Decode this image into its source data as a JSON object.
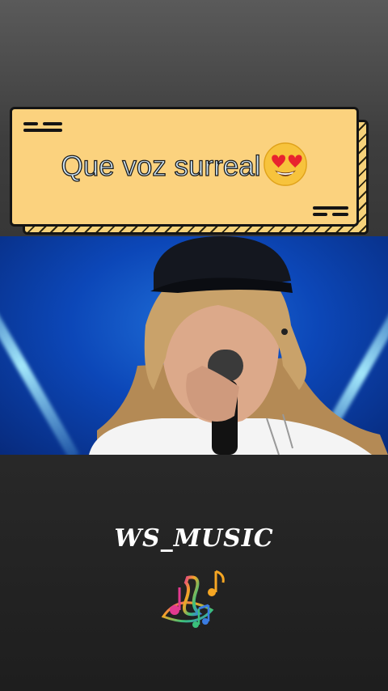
{
  "caption": {
    "text": "Que voz surreal",
    "emoji": "heart-eyes-emoji"
  },
  "video": {
    "description_icon": "singer-with-microphone"
  },
  "footer": {
    "channel_name": "WS_MUSIC",
    "logo_icon": "music-notes-icon"
  },
  "colors": {
    "caption_background": "#fbd27e",
    "caption_text": "#cfe6f6",
    "stage_blue": "#0c47b8",
    "beam_cyan": "#a8eeff"
  }
}
